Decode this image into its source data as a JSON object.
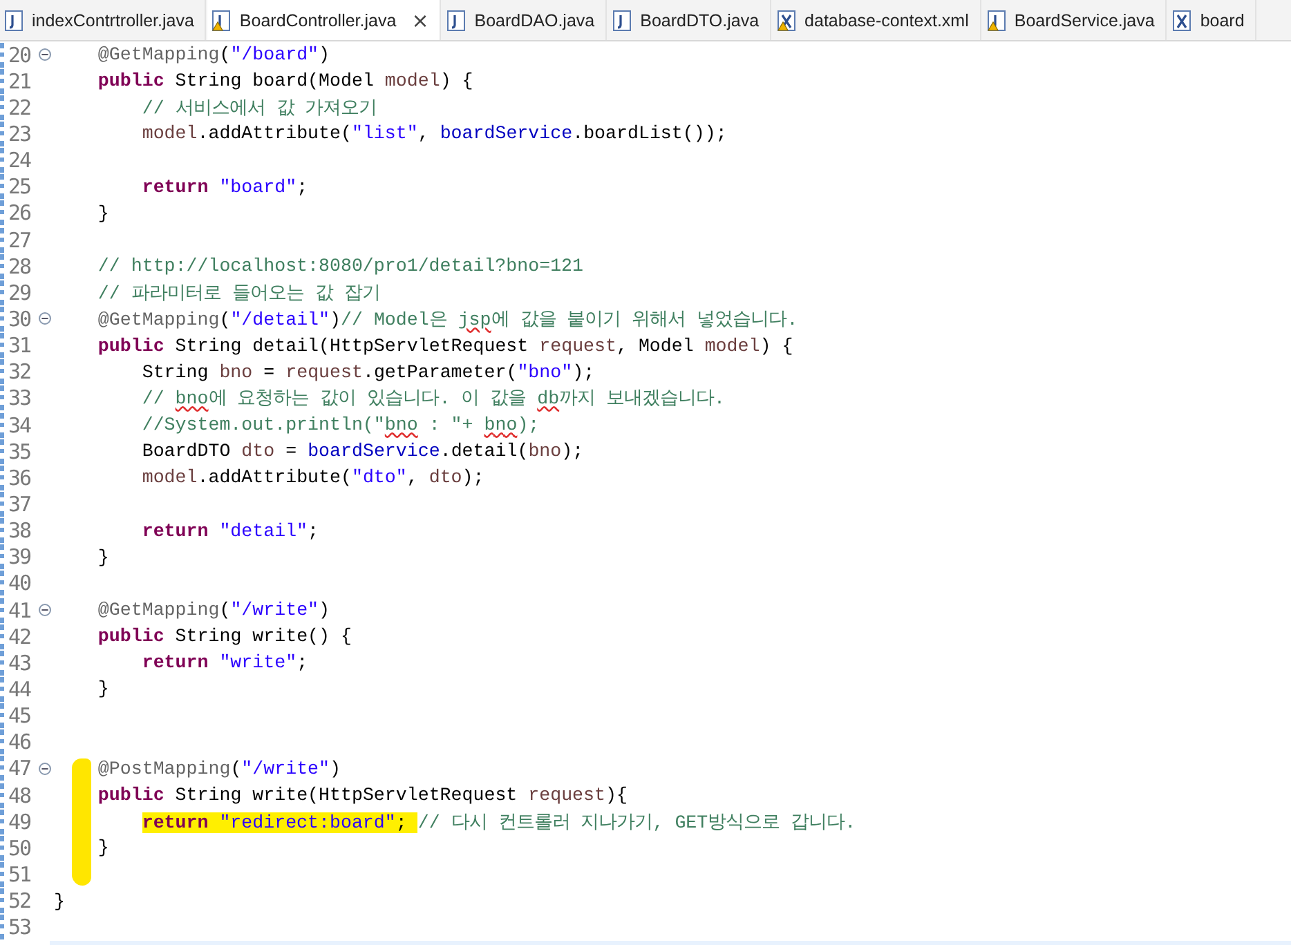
{
  "tabs": [
    {
      "label": "indexContrtroller.java",
      "kind": "java",
      "warning": false,
      "selected": false,
      "closable": false
    },
    {
      "label": "BoardController.java",
      "kind": "java",
      "warning": true,
      "selected": true,
      "closable": true,
      "close": "×"
    },
    {
      "label": "BoardDAO.java",
      "kind": "java",
      "warning": false,
      "selected": false,
      "closable": false
    },
    {
      "label": "BoardDTO.java",
      "kind": "java",
      "warning": false,
      "selected": false,
      "closable": false
    },
    {
      "label": "database-context.xml",
      "kind": "xml",
      "warning": true,
      "selected": false,
      "closable": false
    },
    {
      "label": "BoardService.java",
      "kind": "java",
      "warning": true,
      "selected": false,
      "closable": false
    },
    {
      "label": "board",
      "kind": "xml",
      "warning": false,
      "selected": false,
      "closable": false
    }
  ],
  "lines": [
    {
      "number": "20",
      "fold": true,
      "marker": false,
      "tokens": [
        {
          "kind": "annotation",
          "t": "    @GetMapping"
        },
        {
          "kind": "plain",
          "t": "("
        },
        {
          "kind": "string",
          "t": "\"/board\""
        },
        {
          "kind": "plain",
          "t": ")"
        }
      ]
    },
    {
      "number": "21",
      "fold": false,
      "marker": false,
      "tokens": [
        {
          "kind": "keyword",
          "t": "    public"
        },
        {
          "kind": "plain",
          "t": " String board(Model "
        },
        {
          "kind": "local",
          "t": "model"
        },
        {
          "kind": "plain",
          "t": ") {"
        }
      ]
    },
    {
      "number": "22",
      "fold": false,
      "marker": false,
      "tokens": [
        {
          "kind": "comment",
          "t": "        // 서비스에서 값 가져오기"
        }
      ]
    },
    {
      "number": "23",
      "fold": false,
      "marker": false,
      "tokens": [
        {
          "kind": "local",
          "t": "        model"
        },
        {
          "kind": "plain",
          "t": ".addAttribute("
        },
        {
          "kind": "string",
          "t": "\"list\""
        },
        {
          "kind": "plain",
          "t": ", "
        },
        {
          "kind": "field",
          "t": "boardService"
        },
        {
          "kind": "plain",
          "t": ".boardList());"
        }
      ]
    },
    {
      "number": "24",
      "fold": false,
      "marker": false
    },
    {
      "number": "25",
      "fold": false,
      "marker": false,
      "tokens": [
        {
          "kind": "keyword",
          "t": "        return "
        },
        {
          "kind": "string",
          "t": "\"board\""
        },
        {
          "kind": "plain",
          "t": ";"
        }
      ]
    },
    {
      "number": "26",
      "fold": false,
      "marker": false,
      "tokens": [
        {
          "kind": "plain",
          "t": "    }"
        }
      ]
    },
    {
      "number": "27",
      "fold": false,
      "marker": false
    },
    {
      "number": "28",
      "fold": false,
      "marker": false,
      "tokens": [
        {
          "kind": "comment",
          "t": "    // http://localhost:8080/pro1/detail?bno=121"
        }
      ]
    },
    {
      "number": "29",
      "fold": false,
      "marker": false,
      "tokens": [
        {
          "kind": "comment",
          "t": "    // 파라미터로 들어오는 값 잡기"
        }
      ]
    },
    {
      "number": "30",
      "fold": true,
      "marker": false,
      "tokens": [
        {
          "kind": "annotation",
          "t": "    @GetMapping"
        },
        {
          "kind": "plain",
          "t": "("
        },
        {
          "kind": "string",
          "t": "\"/detail\""
        },
        {
          "kind": "plain",
          "t": ")"
        },
        {
          "kind": "comment",
          "t": "// Model은 "
        },
        {
          "kind": "comment",
          "t": "jsp",
          "misspelled": true
        },
        {
          "kind": "comment",
          "t": "에 값을 붙이기 위해서 넣었습니다."
        }
      ]
    },
    {
      "number": "31",
      "fold": false,
      "marker": false,
      "tokens": [
        {
          "kind": "keyword",
          "t": "    public"
        },
        {
          "kind": "plain",
          "t": " String detail(HttpServletRequest "
        },
        {
          "kind": "local",
          "t": "request"
        },
        {
          "kind": "plain",
          "t": ", Model "
        },
        {
          "kind": "local",
          "t": "model"
        },
        {
          "kind": "plain",
          "t": ") {"
        }
      ]
    },
    {
      "number": "32",
      "fold": false,
      "marker": false,
      "tokens": [
        {
          "kind": "plain",
          "t": "        String "
        },
        {
          "kind": "local",
          "t": "bno"
        },
        {
          "kind": "plain",
          "t": " = "
        },
        {
          "kind": "local",
          "t": "request"
        },
        {
          "kind": "plain",
          "t": ".getParameter("
        },
        {
          "kind": "string",
          "t": "\"bno\""
        },
        {
          "kind": "plain",
          "t": ");"
        }
      ]
    },
    {
      "number": "33",
      "fold": false,
      "marker": false,
      "tokens": [
        {
          "kind": "comment",
          "t": "        // "
        },
        {
          "kind": "comment",
          "t": "bno",
          "misspelled": true
        },
        {
          "kind": "comment",
          "t": "에 요청하는 값이 있습니다. 이 값을 "
        },
        {
          "kind": "comment",
          "t": "db",
          "misspelled": true
        },
        {
          "kind": "comment",
          "t": "까지 보내겠습니다."
        }
      ]
    },
    {
      "number": "34",
      "fold": false,
      "marker": false,
      "tokens": [
        {
          "kind": "comment",
          "t": "        //System.out.println(\""
        },
        {
          "kind": "comment",
          "t": "bno",
          "misspelled": true
        },
        {
          "kind": "comment",
          "t": " : \"+ "
        },
        {
          "kind": "comment",
          "t": "bno",
          "misspelled": true
        },
        {
          "kind": "comment",
          "t": ");"
        }
      ]
    },
    {
      "number": "35",
      "fold": false,
      "marker": false,
      "tokens": [
        {
          "kind": "plain",
          "t": "        BoardDTO "
        },
        {
          "kind": "local",
          "t": "dto"
        },
        {
          "kind": "plain",
          "t": " = "
        },
        {
          "kind": "field",
          "t": "boardService"
        },
        {
          "kind": "plain",
          "t": ".detail("
        },
        {
          "kind": "local",
          "t": "bno"
        },
        {
          "kind": "plain",
          "t": ");"
        }
      ]
    },
    {
      "number": "36",
      "fold": false,
      "marker": false,
      "tokens": [
        {
          "kind": "local",
          "t": "        model"
        },
        {
          "kind": "plain",
          "t": ".addAttribute("
        },
        {
          "kind": "string",
          "t": "\"dto\""
        },
        {
          "kind": "plain",
          "t": ", "
        },
        {
          "kind": "local",
          "t": "dto"
        },
        {
          "kind": "plain",
          "t": ");"
        }
      ]
    },
    {
      "number": "37",
      "fold": false,
      "marker": false
    },
    {
      "number": "38",
      "fold": false,
      "marker": false,
      "tokens": [
        {
          "kind": "keyword",
          "t": "        return "
        },
        {
          "kind": "string",
          "t": "\"detail\""
        },
        {
          "kind": "plain",
          "t": ";"
        }
      ]
    },
    {
      "number": "39",
      "fold": false,
      "marker": false,
      "tokens": [
        {
          "kind": "plain",
          "t": "    }"
        }
      ]
    },
    {
      "number": "40",
      "fold": false,
      "marker": false
    },
    {
      "number": "41",
      "fold": true,
      "marker": false,
      "tokens": [
        {
          "kind": "annotation",
          "t": "    @GetMapping"
        },
        {
          "kind": "plain",
          "t": "("
        },
        {
          "kind": "string",
          "t": "\"/write\""
        },
        {
          "kind": "plain",
          "t": ")"
        }
      ]
    },
    {
      "number": "42",
      "fold": false,
      "marker": false,
      "tokens": [
        {
          "kind": "keyword",
          "t": "    public"
        },
        {
          "kind": "plain",
          "t": " String write() {"
        }
      ]
    },
    {
      "number": "43",
      "fold": false,
      "marker": false,
      "tokens": [
        {
          "kind": "keyword",
          "t": "        return "
        },
        {
          "kind": "string",
          "t": "\"write\""
        },
        {
          "kind": "plain",
          "t": ";"
        }
      ]
    },
    {
      "number": "44",
      "fold": false,
      "marker": false,
      "tokens": [
        {
          "kind": "plain",
          "t": "    }"
        }
      ]
    },
    {
      "number": "45",
      "fold": false,
      "marker": false
    },
    {
      "number": "46",
      "fold": false,
      "marker": false
    },
    {
      "number": "47",
      "fold": true,
      "marker": true,
      "tokens": [
        {
          "kind": "annotation",
          "t": "    @PostMapping"
        },
        {
          "kind": "plain",
          "t": "("
        },
        {
          "kind": "string",
          "t": "\"/write\""
        },
        {
          "kind": "plain",
          "t": ")"
        }
      ]
    },
    {
      "number": "48",
      "fold": false,
      "marker": true,
      "tokens": [
        {
          "kind": "keyword",
          "t": "    public"
        },
        {
          "kind": "plain",
          "t": " String write(HttpServletRequest "
        },
        {
          "kind": "local",
          "t": "request"
        },
        {
          "kind": "plain",
          "t": "){"
        }
      ]
    },
    {
      "number": "49",
      "fold": false,
      "marker": true,
      "tokens": [
        {
          "kind": "keyword",
          "t": "        return ",
          "highlight": true
        },
        {
          "kind": "string",
          "t": "\"redirect:board\"",
          "highlight": true
        },
        {
          "kind": "plain",
          "t": "; ",
          "highlight": true
        },
        {
          "kind": "comment",
          "t": "// 다시 컨트롤러 지나가기, GET방식으로 갑니다."
        }
      ]
    },
    {
      "number": "50",
      "fold": false,
      "marker": true,
      "tokens": [
        {
          "kind": "plain",
          "t": "    }"
        }
      ]
    },
    {
      "number": "51",
      "fold": false,
      "marker": true
    },
    {
      "number": "52",
      "fold": false,
      "marker": false,
      "tokens": [
        {
          "kind": "plain",
          "t": "}"
        }
      ]
    },
    {
      "number": "53",
      "fold": false,
      "marker": false
    }
  ]
}
